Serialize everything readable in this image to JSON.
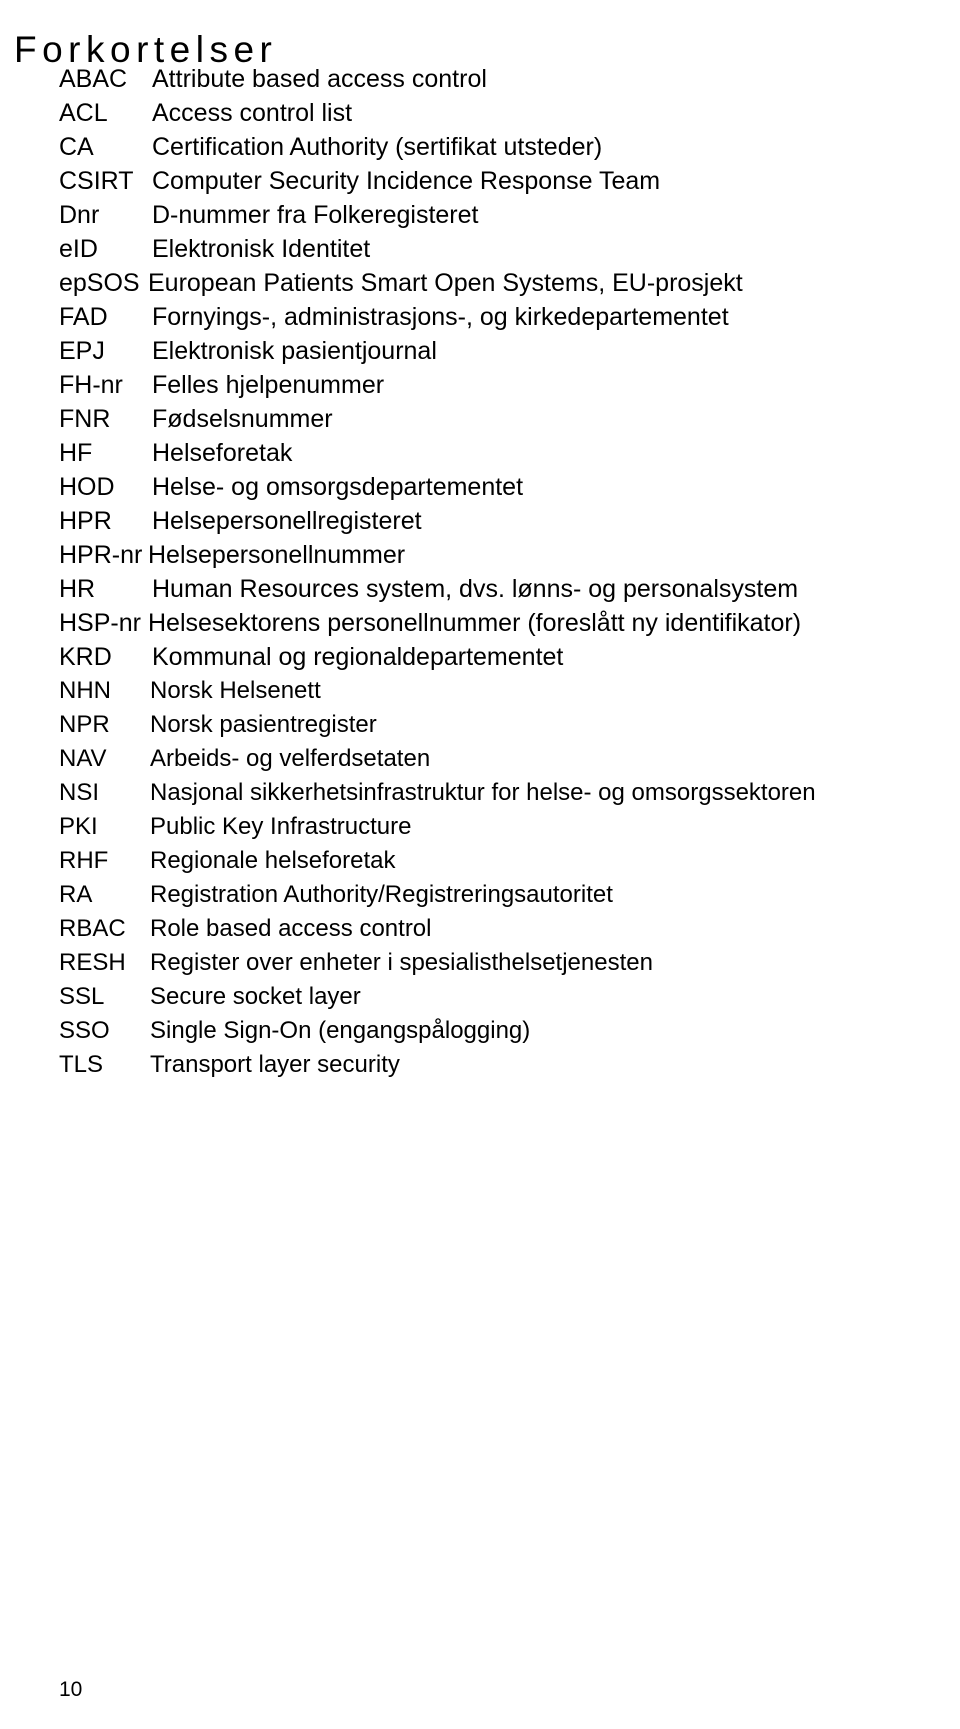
{
  "document": {
    "title": "Forkortelser",
    "page_number": "10",
    "text_color": "#000000",
    "background_color": "#ffffff"
  },
  "abbreviations": [
    {
      "term": "ABAC",
      "description": "Attribute based access control"
    },
    {
      "term": "ACL",
      "description": "Access control list"
    },
    {
      "term": "CA",
      "description": "Certification Authority (sertifikat utsteder)"
    },
    {
      "term": "CSIRT",
      "description": "Computer Security Incidence Response Team"
    },
    {
      "term": "Dnr",
      "description": "D-nummer fra Folkeregisteret"
    },
    {
      "term": "eID",
      "description": "Elektronisk Identitet"
    },
    {
      "term": "epSOS",
      "description": "European Patients Smart Open Systems, EU-prosjekt"
    },
    {
      "term": "FAD",
      "description": "Fornyings-, administrasjons-, og kirkedepartementet"
    },
    {
      "term": "EPJ",
      "description": "Elektronisk pasientjournal"
    },
    {
      "term": "FH-nr",
      "description": "Felles hjelpenummer"
    },
    {
      "term": "FNR",
      "description": "Fødselsnummer"
    },
    {
      "term": "HF",
      "description": "Helseforetak"
    },
    {
      "term": "HOD",
      "description": "Helse- og omsorgsdepartementet"
    },
    {
      "term": "HPR",
      "description": "Helsepersonellregisteret"
    },
    {
      "term": "HPR-nr",
      "description": "Helsepersonellnummer"
    },
    {
      "term": "HR",
      "description": "Human Resources system, dvs. lønns- og personalsystem"
    },
    {
      "term": "HSP-nr",
      "description": "Helsesektorens personellnummer (foreslått ny identifikator)"
    },
    {
      "term": "KRD",
      "description": "Kommunal og regionaldepartementet"
    },
    {
      "term": "NHN",
      "description": "Norsk Helsenett"
    },
    {
      "term": "NPR",
      "description": "Norsk pasientregister"
    },
    {
      "term": "NAV",
      "description": "Arbeids- og velferdsetaten"
    },
    {
      "term": "NSI",
      "description": "Nasjonal sikkerhetsinfrastruktur for helse- og omsorgssektoren"
    },
    {
      "term": "PKI",
      "description": "Public Key Infrastructure"
    },
    {
      "term": "RHF",
      "description": "Regionale helseforetak"
    },
    {
      "term": "RA",
      "description": "Registration Authority/Registreringsautoritet"
    },
    {
      "term": "RBAC",
      "description": "Role based access control"
    },
    {
      "term": "RESH",
      "description": "Register over enheter i spesialisthelsetjenesten"
    },
    {
      "term": "SSL",
      "description": "Secure socket layer"
    },
    {
      "term": "SSO",
      "description": "Single Sign-On (engangspålogging)"
    },
    {
      "term": "TLS",
      "description": "Transport layer security"
    }
  ]
}
